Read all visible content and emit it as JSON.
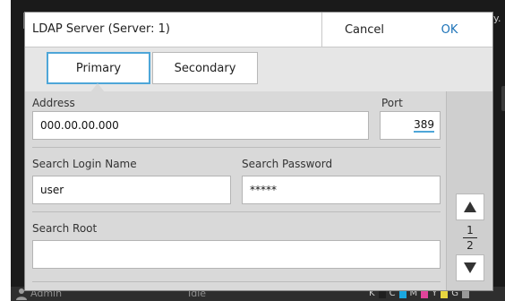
{
  "background": {
    "tip_text": "y.",
    "status": {
      "user": "Admin",
      "state": "Idle",
      "inks": [
        {
          "label": "K",
          "color": "#1f1f1f"
        },
        {
          "label": "C",
          "color": "#1aa7e0"
        },
        {
          "label": "M",
          "color": "#e0449a"
        },
        {
          "label": "Y",
          "color": "#e8d640"
        },
        {
          "label": "G",
          "color": "#9a9a9a"
        }
      ]
    }
  },
  "dialog": {
    "title": "LDAP Server (Server: 1)",
    "cancel_label": "Cancel",
    "ok_label": "OK",
    "ok_color": "#1d73b8"
  },
  "tabs": [
    {
      "label": "Primary",
      "selected": true
    },
    {
      "label": "Secondary",
      "selected": false
    }
  ],
  "form": {
    "address": {
      "label": "Address",
      "value": "000.00.00.000"
    },
    "port": {
      "label": "Port",
      "value": "389"
    },
    "search_login_name": {
      "label": "Search Login Name",
      "value": "user"
    },
    "search_password": {
      "label": "Search Password",
      "value": "*****"
    },
    "search_root": {
      "label": "Search Root",
      "value": ""
    }
  },
  "pager": {
    "current": "1",
    "total": "2",
    "up_icon": "triangle-up-icon",
    "down_icon": "triangle-down-icon"
  }
}
